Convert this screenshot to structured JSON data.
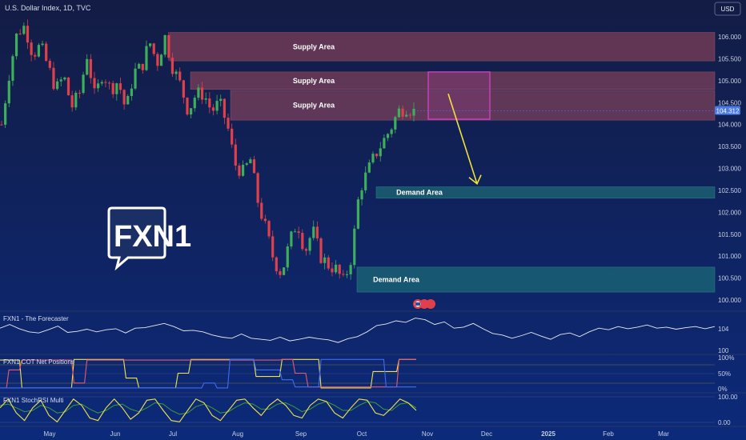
{
  "header": {
    "symbol": "U.S. Dollar Index, 1D, TVC",
    "currency": "USD"
  },
  "brand": {
    "logo_text": "FXN1"
  },
  "colors": {
    "background_top": "#131c44",
    "background_bottom": "#0c2a7a",
    "candle_up": "#3fae5a",
    "candle_down": "#e0404a",
    "supply_zone": "#a14a5c",
    "demand_zone": "#1f7a7a",
    "target_box": "#e23fd0",
    "arrow": "#f2e337",
    "price_tag": "#4a7ae8",
    "forecaster_line": "#e9ecf2",
    "cot_yellow": "#f1e44a",
    "cot_red": "#e85a6a",
    "cot_blue": "#3f6cf0",
    "stoch_yellow": "#f1e44a",
    "stoch_green": "#3f9a3a"
  },
  "chart_data": [
    {
      "type": "candlestick",
      "title": "U.S. Dollar Index, 1D, TVC",
      "ylim": [
        99.75,
        106.4
      ],
      "y_ticks": [
        "106.000",
        "105.500",
        "105.000",
        "104.500",
        "104.000",
        "103.500",
        "103.000",
        "102.500",
        "102.000",
        "101.500",
        "101.000",
        "100.500",
        "100.000"
      ],
      "x_ticks": [
        "May",
        "Jun",
        "Jul",
        "Aug",
        "Sep",
        "Oct",
        "Nov",
        "Dec",
        "2025",
        "Feb",
        "Mar"
      ],
      "last_price": "104.312",
      "close_path": [
        104.0,
        105.2,
        106.1,
        106.25,
        105.6,
        105.8,
        105.3,
        104.8,
        105.1,
        104.4,
        104.7,
        105.6,
        104.6,
        105.2,
        104.8,
        105.0,
        104.3,
        105.2,
        105.3,
        105.9,
        105.4,
        106.0,
        105.3,
        104.9,
        104.3,
        104.7,
        104.7,
        104.3,
        104.5,
        104.0,
        103.1,
        102.9,
        103.2,
        102.2,
        101.6,
        100.9,
        100.6,
        101.3,
        101.8,
        101.1,
        101.6,
        101.0,
        100.8,
        100.7,
        100.4,
        101.0,
        102.5,
        102.9,
        103.3,
        103.6,
        103.9,
        104.3,
        104.4,
        104.3
      ],
      "zones": [
        {
          "label": "Supply Area",
          "kind": "supply",
          "y_high": 106.1,
          "y_low": 105.45
        },
        {
          "label": "Supply Area",
          "kind": "supply",
          "y_high": 105.2,
          "y_low": 104.8
        },
        {
          "label": "Supply Area",
          "kind": "supply",
          "y_high": 104.78,
          "y_low": 104.1
        },
        {
          "label": "Demand Area",
          "kind": "demand",
          "y_high": 102.58,
          "y_low": 102.32
        },
        {
          "label": "Demand Area",
          "kind": "demand",
          "y_high": 100.75,
          "y_low": 100.18
        }
      ],
      "target_box": {
        "y_high": 105.2,
        "y_low": 104.12
      },
      "arrow": {
        "from": 104.7,
        "to": 102.65
      }
    },
    {
      "type": "line",
      "title": "FXN1 - The Forecaster",
      "y_ticks": [
        "104",
        "100"
      ],
      "ylim": [
        99.5,
        106.0
      ],
      "series": [
        {
          "values": [
            103.7,
            104.4,
            103.6,
            103.0,
            102.8,
            103.4,
            104.1,
            102.9,
            103.1,
            103.5,
            103.0,
            103.4,
            103.6,
            102.8,
            103.7,
            103.8,
            104.2,
            104.6,
            104.0,
            103.2,
            103.3,
            103.0,
            102.4,
            102.0,
            101.8,
            102.6,
            101.8,
            101.6,
            101.4,
            102.0,
            101.3,
            101.6,
            102.0,
            101.7,
            101.5,
            101.0,
            101.7,
            102.1,
            103.0,
            104.2,
            104.5,
            105.1,
            104.8,
            105.6,
            105.3,
            104.4,
            104.9,
            103.7,
            103.9,
            104.6,
            103.6,
            102.7,
            102.4,
            101.8,
            102.3,
            102.9,
            102.2,
            101.6,
            102.5,
            102.8,
            102.1,
            103.0,
            103.7,
            103.4,
            104.0,
            103.6,
            103.9,
            104.3,
            103.7,
            103.9,
            103.5,
            103.8,
            104.0,
            103.6,
            104.0
          ]
        }
      ]
    },
    {
      "type": "line",
      "title": "FXN1 COT Net Positions",
      "y_ticks": [
        "100%",
        "50%",
        "0%"
      ],
      "ylim": [
        0,
        100
      ],
      "series": [
        {
          "values": [
            90,
            90,
            5,
            5,
            5,
            5,
            92,
            92,
            92,
            92,
            35,
            5,
            5,
            5,
            50,
            92,
            92,
            92,
            92,
            92,
            40,
            40,
            92,
            92,
            92,
            5,
            5,
            5,
            5,
            55,
            55,
            92,
            92
          ]
        },
        {
          "values": [
            5,
            60,
            90,
            90,
            90,
            90,
            20,
            90,
            90,
            90,
            90,
            90,
            90,
            90,
            90,
            90,
            90,
            90,
            90,
            90,
            90,
            90,
            92,
            50,
            8,
            8,
            8,
            8,
            8,
            8,
            8,
            92,
            92
          ]
        },
        {
          "values": [
            5,
            5,
            5,
            5,
            5,
            5,
            5,
            5,
            5,
            5,
            5,
            5,
            5,
            5,
            5,
            5,
            20,
            5,
            92,
            92,
            60,
            60,
            30,
            8,
            8,
            92,
            92,
            92,
            92,
            92,
            8,
            8,
            8
          ]
        }
      ]
    },
    {
      "type": "line",
      "title": "FXN1 StochRSI Multi",
      "y_ticks": [
        "100.00",
        "0.00"
      ],
      "ylim": [
        -10,
        110
      ],
      "series": [
        {
          "values": [
            60,
            95,
            40,
            10,
            60,
            90,
            30,
            5,
            50,
            95,
            70,
            20,
            10,
            60,
            95,
            60,
            15,
            40,
            90,
            95,
            50,
            10,
            5,
            50,
            95,
            80,
            30,
            10,
            50,
            90,
            95,
            60,
            30,
            70,
            95,
            70,
            30,
            20,
            70,
            95,
            85,
            40,
            20,
            60,
            95,
            90,
            40,
            30,
            60,
            95,
            80,
            50
          ]
        },
        {
          "values": [
            70,
            75,
            60,
            45,
            50,
            70,
            60,
            40,
            45,
            70,
            75,
            55,
            40,
            50,
            70,
            75,
            55,
            45,
            60,
            80,
            75,
            50,
            35,
            40,
            65,
            75,
            60,
            40,
            45,
            65,
            80,
            75,
            55,
            55,
            75,
            80,
            65,
            45,
            55,
            75,
            85,
            70,
            50,
            50,
            70,
            85,
            80,
            55,
            50,
            75,
            80,
            60
          ]
        }
      ]
    }
  ]
}
